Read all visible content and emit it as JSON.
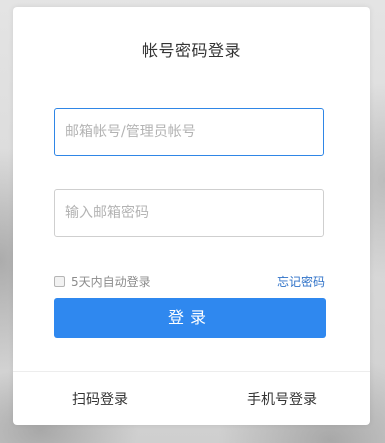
{
  "login": {
    "title": "帐号密码登录",
    "account_placeholder": "邮箱帐号/管理员帐号",
    "account_value": "",
    "password_placeholder": "输入邮箱密码",
    "password_value": "",
    "remember_label": "5天内自动登录",
    "remember_checked": false,
    "forgot_label": "忘记密码",
    "submit_label": "登录"
  },
  "footer": {
    "scan_login": "扫码登录",
    "phone_login": "手机号登录"
  },
  "colors": {
    "primary": "#2f88ef",
    "link": "#2f72c8",
    "focus_border": "#2f86e6"
  }
}
